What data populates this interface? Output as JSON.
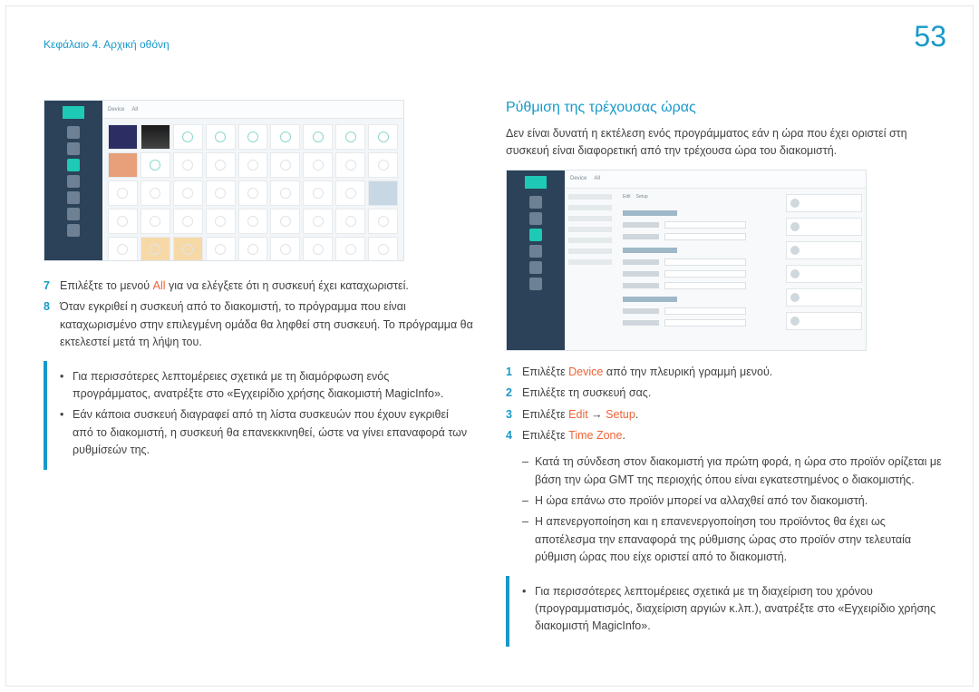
{
  "page": {
    "number": "53",
    "chapter_label": "Κεφάλαιο 4. Αρχική οθόνη"
  },
  "left": {
    "ol7": "Επιλέξτε το μενού ",
    "ol7_em": "All",
    "ol7_tail": " για να ελέγξετε ότι η συσκευή έχει καταχωριστεί.",
    "ol8": "Όταν εγκριθεί η συσκευή από το διακομιστή, το πρόγραμμα που είναι καταχωρισμένο στην επιλεγμένη ομάδα θα ληφθεί στη συσκευή. Το πρόγραμμα θα εκτελεστεί μετά τη λήψη του.",
    "note1": "Για περισσότερες λεπτομέρειες σχετικά με τη διαμόρφωση ενός προγράμματος, ανατρέξτε στο «Εγχειρίδιο χρήσης διακομιστή MagicInfo».",
    "note2": "Εάν κάποια συσκευή διαγραφεί από τη λίστα συσκευών που έχουν εγκριθεί από το διακομιστή, η συσκευή θα επανεκκινηθεί, ώστε να γίνει επαναφορά των ρυθμίσεών της."
  },
  "right": {
    "heading": "Ρύθμιση της τρέχουσας ώρας",
    "intro1": "Δεν είναι δυνατή η εκτέλεση ενός προγράμματος εάν η ώρα που έχει οριστεί στη συσκευή είναι διαφορετική από την τρέχουσα ώρα του διακομιστή.",
    "ol1a": "Επιλέξτε ",
    "ol1_em": "Device",
    "ol1b": " από την πλευρική γραμμή μενού.",
    "ol2": "Επιλέξτε τη συσκευή σας.",
    "ol3a": "Επιλέξτε ",
    "ol3_em1": "Edit",
    "ol3_arrow": " → ",
    "ol3_em2": "Setup",
    "ol3b": ".",
    "ol4a": "Επιλέξτε ",
    "ol4_em": "Time Zone",
    "ol4b": ".",
    "d1": "Κατά τη σύνδεση στον διακομιστή για πρώτη φορά, η ώρα στο προϊόν ορίζεται με βάση την ώρα GMT της περιοχής όπου είναι εγκατεστημένος ο διακομιστής.",
    "d2": "Η ώρα επάνω στο προϊόν μπορεί να αλλαχθεί από τον διακομιστή.",
    "d3": "Η απενεργοποίηση και η επανενεργοποίηση του προϊόντος θα έχει ως αποτέλεσμα την επαναφορά της ρύθμισης ώρας στο προϊόν στην τελευταία ρύθμιση ώρας που είχε οριστεί από το διακομιστή.",
    "note": "Για περισσότερες λεπτομέρειες σχετικά με τη διαχείριση του χρόνου (προγραμματισμός, διαχείριση αργιών κ.λπ.), ανατρέξτε στο «Εγχειρίδιο χρήσης διακομιστή MagicInfo»."
  },
  "thumb_tabs": {
    "t1": "Device",
    "t2": "All"
  }
}
